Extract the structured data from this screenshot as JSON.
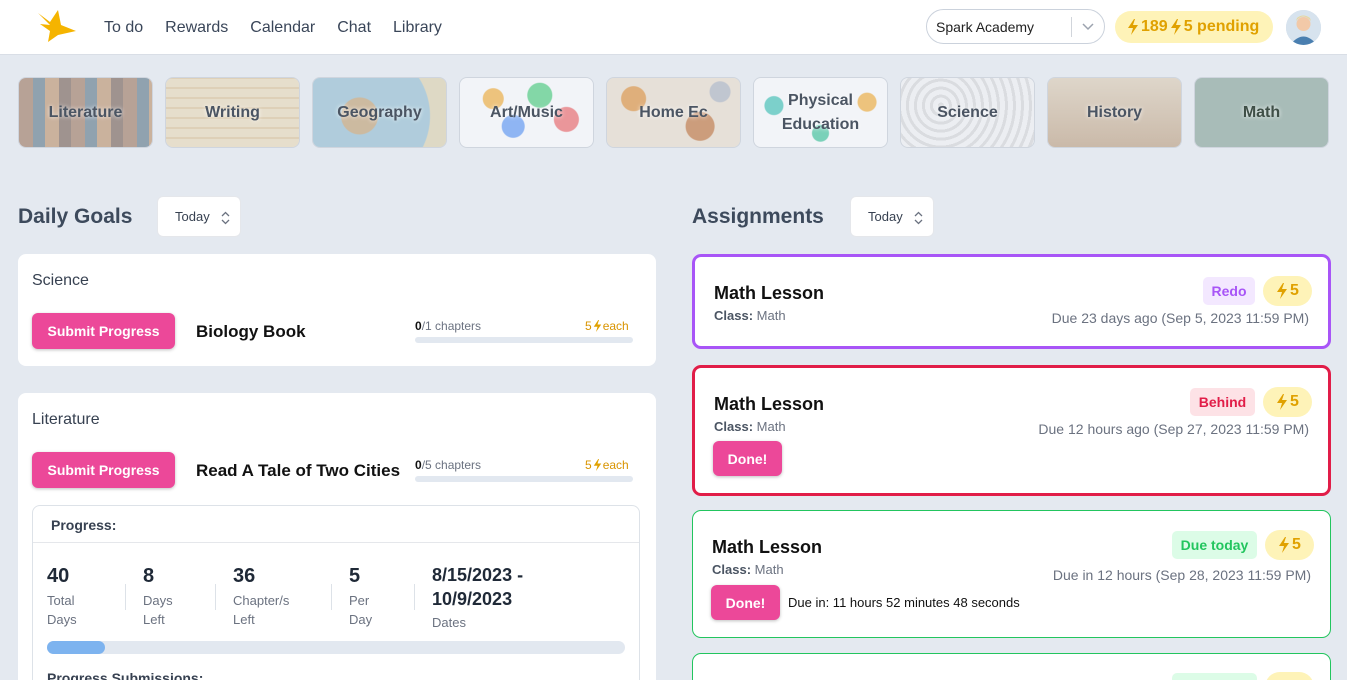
{
  "colors": {
    "accent": "#ec4899",
    "points": "#e0a100",
    "redo": "#a855f7",
    "behind": "#e11d48",
    "due_today": "#22c55e"
  },
  "nav": {
    "items": [
      "To do",
      "Rewards",
      "Calendar",
      "Chat",
      "Library"
    ]
  },
  "header": {
    "school": "Spark Academy",
    "points": "189",
    "pending": "5 pending"
  },
  "subjects": [
    "Literature",
    "Writing",
    "Geography",
    "Art/Music",
    "Home Ec",
    "Physical Education",
    "Science",
    "History",
    "Math"
  ],
  "daily_goals": {
    "title": "Daily Goals",
    "filter": "Today",
    "goals": [
      {
        "subject": "Science",
        "button": "Submit Progress",
        "book": "Biology Book",
        "done": "0",
        "total": "/1 chapters",
        "points": "5",
        "each": "each"
      },
      {
        "subject": "Literature",
        "button": "Submit Progress",
        "book": "Read A Tale of Two Cities",
        "done": "0",
        "total": "/5 chapters",
        "points": "5",
        "each": "each"
      }
    ],
    "progress": {
      "title": "Progress:",
      "stats": [
        {
          "value": "40",
          "label": "Total Days"
        },
        {
          "value": "8",
          "label": "Days Left"
        },
        {
          "value": "36",
          "label": "Chapter/s Left"
        },
        {
          "value": "5",
          "label": "Per Day"
        },
        {
          "value": "8/15/2023 - 10/9/2023",
          "label": "Dates"
        }
      ],
      "fraction": 0.1,
      "submissions_title": "Progress Submissions:"
    }
  },
  "assignments": {
    "title": "Assignments",
    "filter": "Today",
    "items": [
      {
        "title": "Math Lesson",
        "class_label": "Class:",
        "class": "Math",
        "status": "Redo",
        "points": "5",
        "due": "Due 23 days ago (Sep 5, 2023 11:59 PM)"
      },
      {
        "title": "Math Lesson",
        "class_label": "Class:",
        "class": "Math",
        "status": "Behind",
        "points": "5",
        "due": "Due 12 hours ago (Sep 27, 2023 11:59 PM)",
        "button": "Done!"
      },
      {
        "title": "Math Lesson",
        "class_label": "Class:",
        "class": "Math",
        "status": "Due today",
        "points": "5",
        "due": "Due in 12 hours (Sep 28, 2023 11:59 PM)",
        "button": "Done!",
        "countdown": "Due in: 11 hours 52 minutes 48 seconds"
      }
    ]
  }
}
